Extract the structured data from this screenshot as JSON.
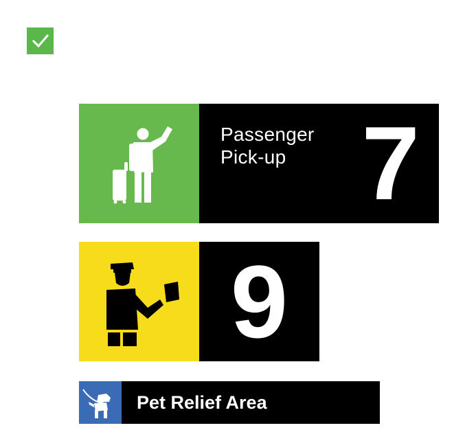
{
  "status": {
    "icon": "checkmark-icon",
    "color": "#5ab84a"
  },
  "signs": [
    {
      "kind": "passenger-pickup",
      "icon": "passenger-pickup-icon",
      "label": "Passenger\nPick-up",
      "number": "7",
      "icon_color": "#67b94e",
      "panel_color": "#000000"
    },
    {
      "kind": "security-officer",
      "icon": "security-officer-icon",
      "number": "9",
      "icon_color": "#f7dc1c",
      "panel_color": "#000000"
    },
    {
      "kind": "pet-relief",
      "icon": "dog-icon",
      "label": "Pet Relief Area",
      "icon_color": "#3b6bb5",
      "panel_color": "#000000"
    }
  ]
}
